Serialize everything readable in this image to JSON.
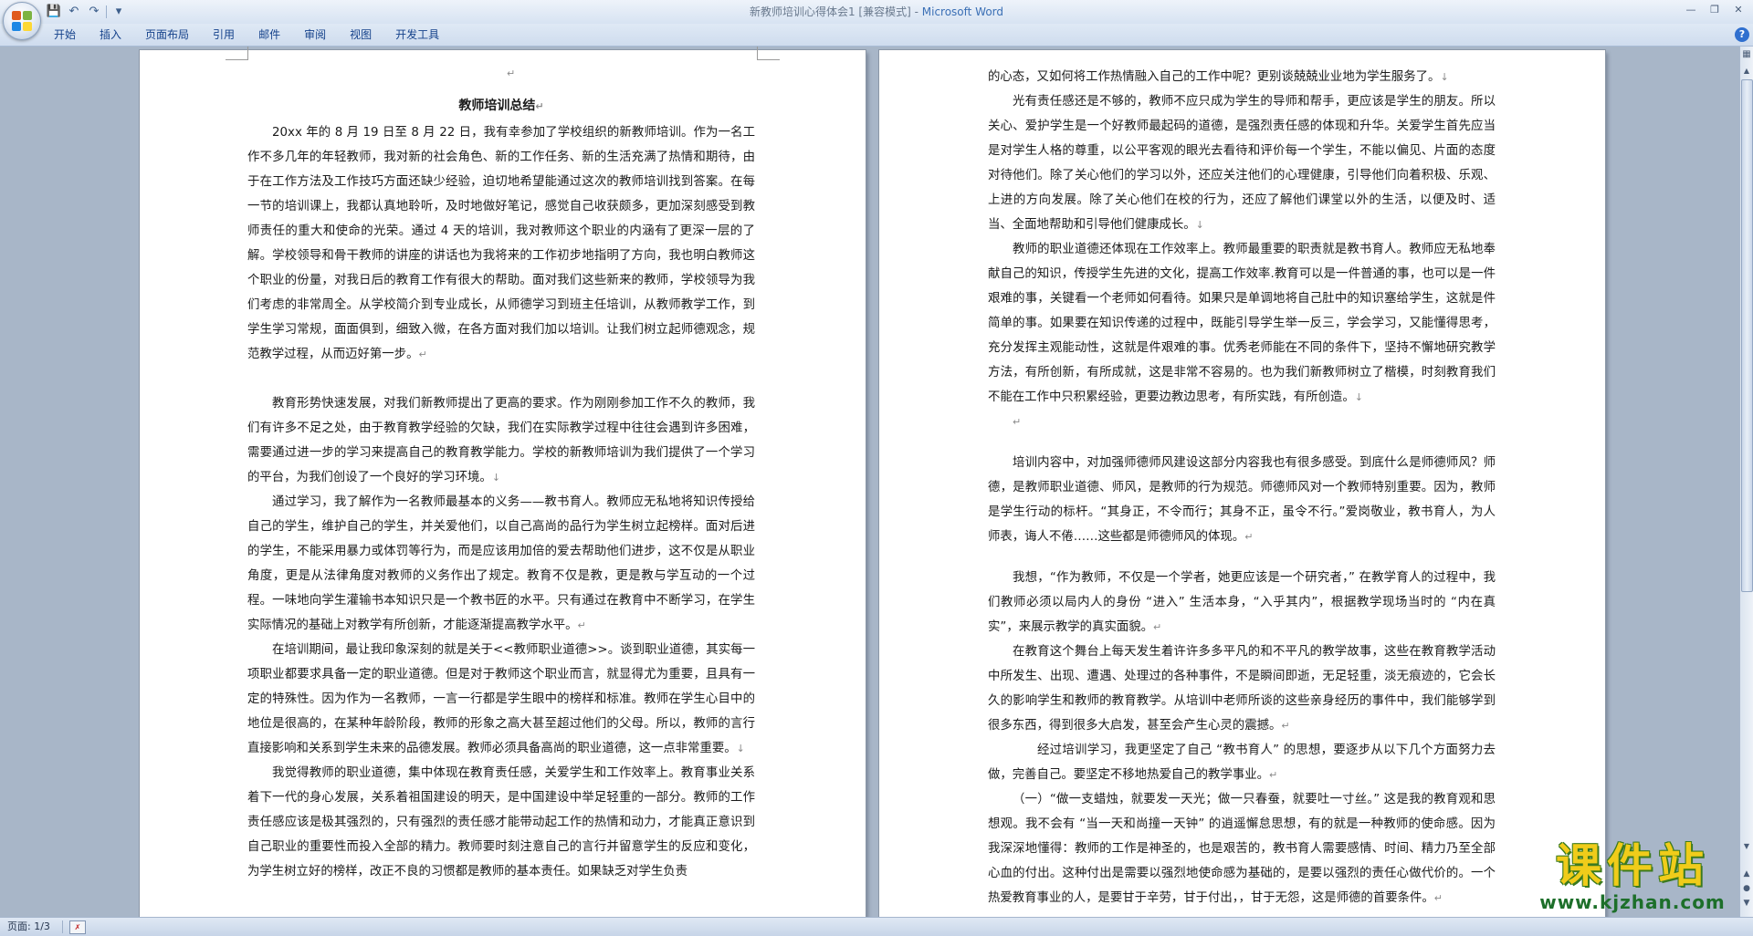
{
  "window": {
    "title_doc": "新教师培训心得体会1 [兼容模式] - ",
    "title_app": "Microsoft Word"
  },
  "ribbon": {
    "tabs": [
      "开始",
      "插入",
      "页面布局",
      "引用",
      "邮件",
      "审阅",
      "视图",
      "开发工具"
    ]
  },
  "status": {
    "page": "页面: 1/3"
  },
  "watermark": {
    "cn": "课件站",
    "url": "www.kjzhan.com"
  },
  "page1": {
    "title": "教师培训总结",
    "paragraphs": [
      "20xx 年的 8 月 19 日至 8 月 22 日，我有幸参加了学校组织的新教师培训。作为一名工作不多几年的年轻教师，我对新的社会角色、新的工作任务、新的生活充满了热情和期待，由于在工作方法及工作技巧方面还缺少经验，迫切地希望能通过这次的教师培训找到答案。在每一节的培训课上，我都认真地聆听，及时地做好笔记，感觉自己收获颇多，更加深刻感受到教师责任的重大和使命的光荣。通过 4 天的培训，我对教师这个职业的内涵有了更深一层的了解。学校领导和骨干教师的讲座的讲话也为我将来的工作初步地指明了方向，我也明白教师这个职业的份量，对我日后的教育工作有很大的帮助。面对我们这些新来的教师，学校领导为我们考虑的非常周全。从学校简介到专业成长，从师德学习到班主任培训，从教师教学工作，到学生学习常规，面面俱到，细致入微，在各方面对我们加以培训。让我们树立起师德观念，规范教学过程，从而迈好第一步。",
      "教育形势快速发展，对我们新教师提出了更高的要求。作为刚刚参加工作不久的教师，我们有许多不足之处，由于教育教学经验的欠缺，我们在实际教学过程中往往会遇到许多困难，需要通过进一步的学习来提高自己的教育教学能力。学校的新教师培训为我们提供了一个学习的平台，为我们创设了一个良好的学习环境。",
      "通过学习，我了解作为一名教师最基本的义务——教书育人。教师应无私地将知识传授给自己的学生，维护自己的学生，并关爱他们，以自己高尚的品行为学生树立起榜样。面对后进的学生，不能采用暴力或体罚等行为，而是应该用加倍的爱去帮助他们进步，这不仅是从职业角度，更是从法律角度对教师的义务作出了规定。教育不仅是教，更是教与学互动的一个过程。一味地向学生灌输书本知识只是一个教书匠的水平。只有通过在教育中不断学习，在学生实际情况的基础上对教学有所创新，才能逐渐提高教学水平。",
      "在培训期间，最让我印象深刻的就是关于<<教师职业道德>>。谈到职业道德，其实每一项职业都要求具备一定的职业道德。但是对于教师这个职业而言，就显得尤为重要，且具有一定的特殊性。因为作为一名教师，一言一行都是学生眼中的榜样和标准。教师在学生心目中的地位是很高的，在某种年龄阶段，教师的形象之高大甚至超过他们的父母。所以，教师的言行直接影响和关系到学生未来的品德发展。教师必须具备高尚的职业道德，这一点非常重要。",
      "我觉得教师的职业道德，集中体现在教育责任感，关爱学生和工作效率上。教育事业关系着下一代的身心发展，关系着祖国建设的明天，是中国建设中举足轻重的一部分。教师的工作责任感应该是极其强烈的，只有强烈的责任感才能带动起工作的热情和动力，才能真正意识到自己职业的重要性而投入全部的精力。教师要时刻注意自己的言行并留意学生的反应和变化，为学生树立好的榜样，改正不良的习惯都是教师的基本责任。如果缺乏对学生负责"
    ]
  },
  "page2": {
    "paragraphs": [
      "的心态，又如何将工作热情融入自己的工作中呢？更别谈兢兢业业地为学生服务了。",
      "光有责任感还是不够的，教师不应只成为学生的导师和帮手，更应该是学生的朋友。所以关心、爱护学生是一个好教师最起码的道德，是强烈责任感的体现和升华。关爱学生首先应当是对学生人格的尊重，以公平客观的眼光去看待和评价每一个学生，不能以偏见、片面的态度对待他们。除了关心他们的学习以外，还应关注他们的心理健康，引导他们向着积极、乐观、上进的方向发展。除了关心他们在校的行为，还应了解他们课堂以外的生活，以便及时、适当、全面地帮助和引导他们健康成长。",
      "教师的职业道德还体现在工作效率上。教师最重要的职责就是教书育人。教师应无私地奉献自己的知识，传授学生先进的文化，提高工作效率.教育可以是一件普通的事，也可以是一件艰难的事，关键看一个老师如何看待。如果只是单调地将自己肚中的知识塞给学生，这就是件简单的事。如果要在知识传递的过程中，既能引导学生举一反三，学会学习，又能懂得思考，充分发挥主观能动性，这就是件艰难的事。优秀老师能在不同的条件下，坚持不懈地研究教学方法，有所创新，有所成就，这是非常不容易的。也为我们新教师树立了楷模，时刻教育我们不能在工作中只积累经验，更要边教边思考，有所实践，有所创造。",
      "培训内容中，对加强师德师风建设这部分内容我也有很多感受。到底什么是师德师风？师德，是教师职业道德、师风，是教师的行为规范。师德师风对一个教师特别重要。因为，教师是学生行动的标杆。“其身正，不令而行；其身不正，虽令不行。”爱岗敬业，教书育人，为人师表，诲人不倦……这些都是师德师风的体现。",
      "我想，“作为教师，不仅是一个学者，她更应该是一个研究者，” 在教学育人的过程中，我们教师必须以局内人的身份 “进入” 生活本身，“入乎其内”，根据教学现场当时的 “内在真实”，来展示教学的真实面貌。",
      "在教育这个舞台上每天发生着许许多多平凡的和不平凡的教学故事，这些在教育教学活动中所发生、出现、遭遇、处理过的各种事件，不是瞬间即逝，无足轻重，淡无痕迹的，它会长久的影响学生和教师的教育教学。从培训中老师所谈的这些亲身经历的事件中，我们能够学到很多东西，得到很多大启发，甚至会产生心灵的震撼。",
      "经过培训学习，我更坚定了自己 “教书育人” 的思想，要逐步从以下几个方面努力去做，完善自己。要坚定不移地热爱自己的教学事业。",
      "（一）“做一支蜡烛，就要发一天光；做一只春蚕，就要吐一寸丝。” 这是我的教育观和思想观。我不会有 “当一天和尚撞一天钟” 的逍遥懈怠思想，有的就是一种教师的使命感。因为我深深地懂得：教师的工作是神圣的，也是艰苦的，教书育人需要感情、时间、精力乃至全部心血的付出。这种付出是需要以强烈地使命感为基础的，是要以强烈的责任心做代价的。一个热爱教育事业的人，是要甘于辛劳，甘于付出，，甘于无怨，这是师德的首要条件。"
    ]
  }
}
